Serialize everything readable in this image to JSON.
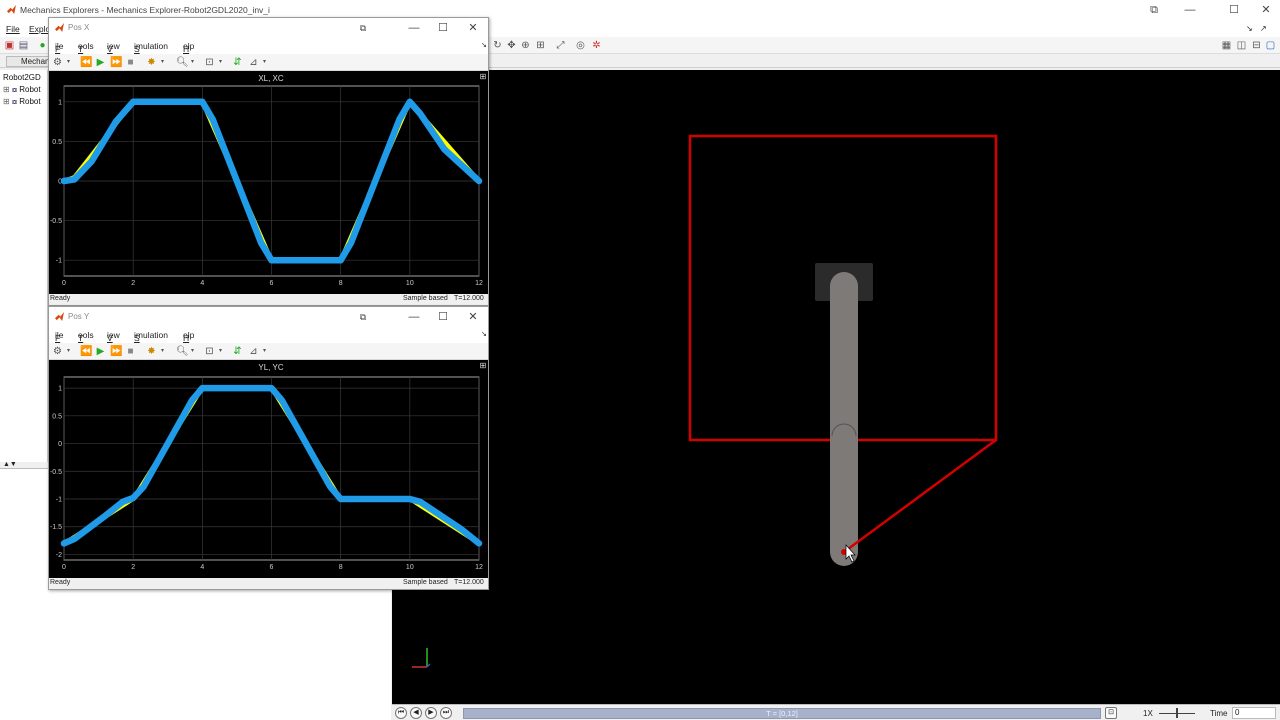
{
  "main_window": {
    "title": "Mechanics Explorers - Mechanics Explorer-Robot2GDL2020_inv_i",
    "menu": [
      "File",
      "Explo"
    ],
    "tab_label": "Mechan",
    "tree_items": [
      "Robot2GD",
      "Robot",
      "Robot"
    ],
    "timeline_label": "T = [0,12]",
    "speed_label": "1X",
    "time_label": "Time",
    "time_value": "0",
    "controls": {
      "minimize": "—",
      "maximize": "☐",
      "close": "✕"
    }
  },
  "scope_x": {
    "title": "Pos X",
    "menu": [
      "File",
      "Tools",
      "View",
      "Simulation",
      "Help"
    ],
    "plot_title": "XL, XC",
    "status_left": "Ready",
    "status_mode": "Sample based",
    "status_time": "T=12.000"
  },
  "scope_y": {
    "title": "Pos Y",
    "menu": [
      "File",
      "Tools",
      "View",
      "Simulation",
      "Help"
    ],
    "plot_title": "YL, YC",
    "status_left": "Ready",
    "status_mode": "Sample based",
    "status_time": "T=12.000"
  },
  "colors": {
    "plot_background": "#000000",
    "series_xl": "#ffff00",
    "series_xc": "#1f9be8",
    "frame_red": "#d40000",
    "link_grey": "#7d7a78"
  },
  "chart_data": [
    {
      "type": "line",
      "title": "XL, XC",
      "xlim": [
        0,
        12
      ],
      "ylim": [
        -1.2,
        1.2
      ],
      "xticks": [
        0,
        2,
        4,
        6,
        8,
        10,
        12
      ],
      "yticks": [
        1,
        0.5,
        0,
        -0.5,
        -1
      ],
      "ytick_labels": [
        "1",
        "0.5",
        "0",
        "-0.5",
        "-1"
      ],
      "grid": true,
      "series": [
        {
          "color": "#ffff00",
          "x": [
            0,
            0.3,
            2,
            4,
            6,
            8,
            10,
            12
          ],
          "y": [
            0,
            0.05,
            1,
            1,
            -1,
            -1,
            1,
            0
          ]
        },
        {
          "color": "#1f9be8",
          "x": [
            0,
            0.3,
            0.8,
            1.5,
            2,
            4,
            4.3,
            5.7,
            6,
            8,
            8.3,
            9.7,
            10,
            10.3,
            11,
            12
          ],
          "y": [
            0,
            0.02,
            0.25,
            0.75,
            1,
            1,
            0.78,
            -0.78,
            -1,
            -1,
            -0.78,
            0.78,
            1,
            0.85,
            0.4,
            0
          ]
        }
      ]
    },
    {
      "type": "line",
      "title": "YL, YC",
      "xlim": [
        0,
        12
      ],
      "ylim": [
        -2.1,
        1.2
      ],
      "xticks": [
        0,
        2,
        4,
        6,
        8,
        10,
        12
      ],
      "yticks": [
        1,
        0.5,
        0,
        -0.5,
        -1,
        -1.5,
        -2
      ],
      "ytick_labels": [
        "1",
        "0.5",
        "0",
        "-0.5",
        "-1",
        "-1.5",
        "-2"
      ],
      "grid": true,
      "series": [
        {
          "color": "#ffff00",
          "x": [
            0,
            2,
            4,
            6,
            8,
            10,
            12
          ],
          "y": [
            -1.8,
            -1,
            1,
            1,
            -1,
            -1,
            -1.8
          ]
        },
        {
          "color": "#1f9be8",
          "x": [
            0,
            0.3,
            1.2,
            1.7,
            2,
            2.3,
            3.7,
            4,
            6,
            6.3,
            7.7,
            8,
            10,
            10.3,
            11.5,
            12
          ],
          "y": [
            -1.8,
            -1.72,
            -1.3,
            -1.05,
            -0.98,
            -0.78,
            0.78,
            1,
            1,
            0.78,
            -0.78,
            -1,
            -1,
            -1.05,
            -1.55,
            -1.8
          ]
        }
      ]
    }
  ]
}
